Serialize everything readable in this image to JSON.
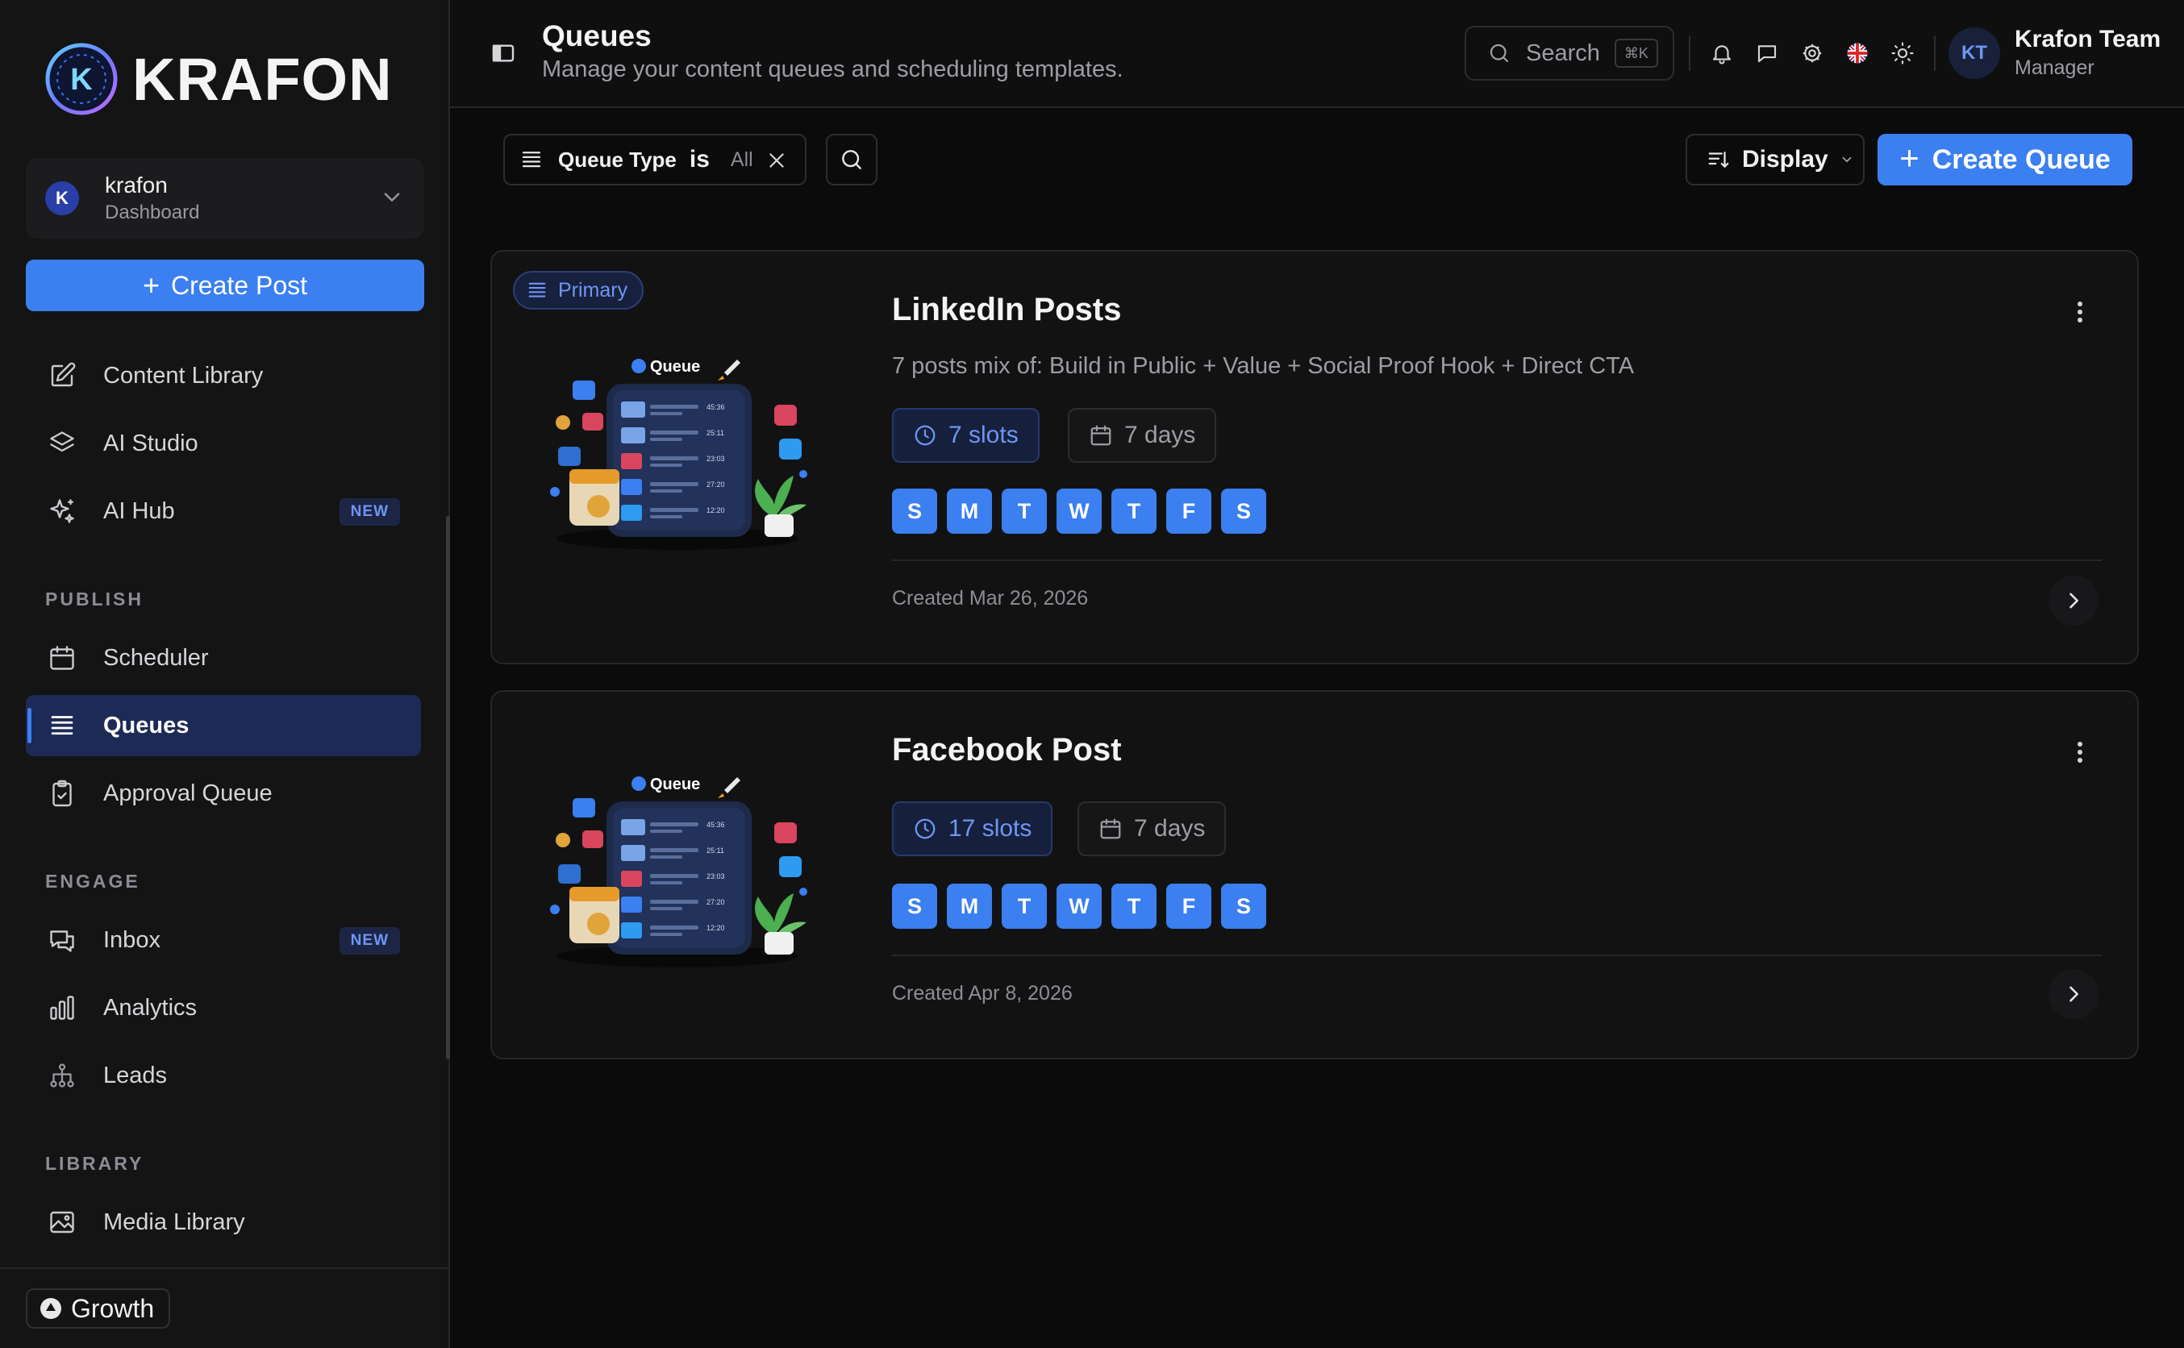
{
  "brand": {
    "name": "KRAFON",
    "logo_letter": "K"
  },
  "workspace": {
    "avatar": "K",
    "name": "krafon",
    "subtitle": "Dashboard"
  },
  "sidebar": {
    "create_post": "Create Post",
    "items": [
      {
        "label": "Content Library",
        "icon": "edit-icon"
      },
      {
        "label": "AI Studio",
        "icon": "layers-icon"
      },
      {
        "label": "AI Hub",
        "icon": "sparkles-icon",
        "badge": "NEW"
      }
    ],
    "publish_label": "PUBLISH",
    "publish_items": [
      {
        "label": "Scheduler",
        "icon": "calendar-icon"
      },
      {
        "label": "Queues",
        "icon": "list-icon",
        "active": true
      },
      {
        "label": "Approval Queue",
        "icon": "clipboard-check-icon"
      }
    ],
    "engage_label": "ENGAGE",
    "engage_items": [
      {
        "label": "Inbox",
        "icon": "chat-icon",
        "badge": "NEW"
      },
      {
        "label": "Analytics",
        "icon": "bar-chart-icon"
      },
      {
        "label": "Leads",
        "icon": "network-icon"
      }
    ],
    "library_label": "LIBRARY",
    "library_items": [
      {
        "label": "Media Library",
        "icon": "image-icon"
      }
    ],
    "plan": "Growth"
  },
  "header": {
    "title": "Queues",
    "subtitle": "Manage your content queues and scheduling templates.",
    "search_label": "Search",
    "search_shortcut": "⌘K",
    "user_initials": "KT",
    "user_name": "Krafon Team",
    "user_role": "Manager"
  },
  "filters": {
    "key": "Queue Type",
    "operator": "is",
    "value": "All",
    "display_label": "Display",
    "create_queue": "Create Queue"
  },
  "queues": [
    {
      "tag": "Primary",
      "thumb_label": "Queue",
      "name": "LinkedIn Posts",
      "description": "7 posts mix of: Build in Public + Value + Social Proof Hook + Direct CTA",
      "slots": "7 slots",
      "days": "7 days",
      "weekdays": [
        "S",
        "M",
        "T",
        "W",
        "T",
        "F",
        "S"
      ],
      "created": "Created Mar 26, 2026"
    },
    {
      "tag": "",
      "thumb_label": "Queue",
      "name": "Facebook Post",
      "description": "",
      "slots": "17 slots",
      "days": "7 days",
      "weekdays": [
        "S",
        "M",
        "T",
        "W",
        "T",
        "F",
        "S"
      ],
      "created": "Created Apr 8, 2026"
    }
  ],
  "thumb_times": [
    "45:36",
    "25:11",
    "23:03",
    "27:20",
    "12:20"
  ],
  "colors": {
    "accent": "#3b7ff0",
    "background": "#0b0b0c",
    "sidebar": "#141415",
    "active_nav": "#1d2a55"
  }
}
